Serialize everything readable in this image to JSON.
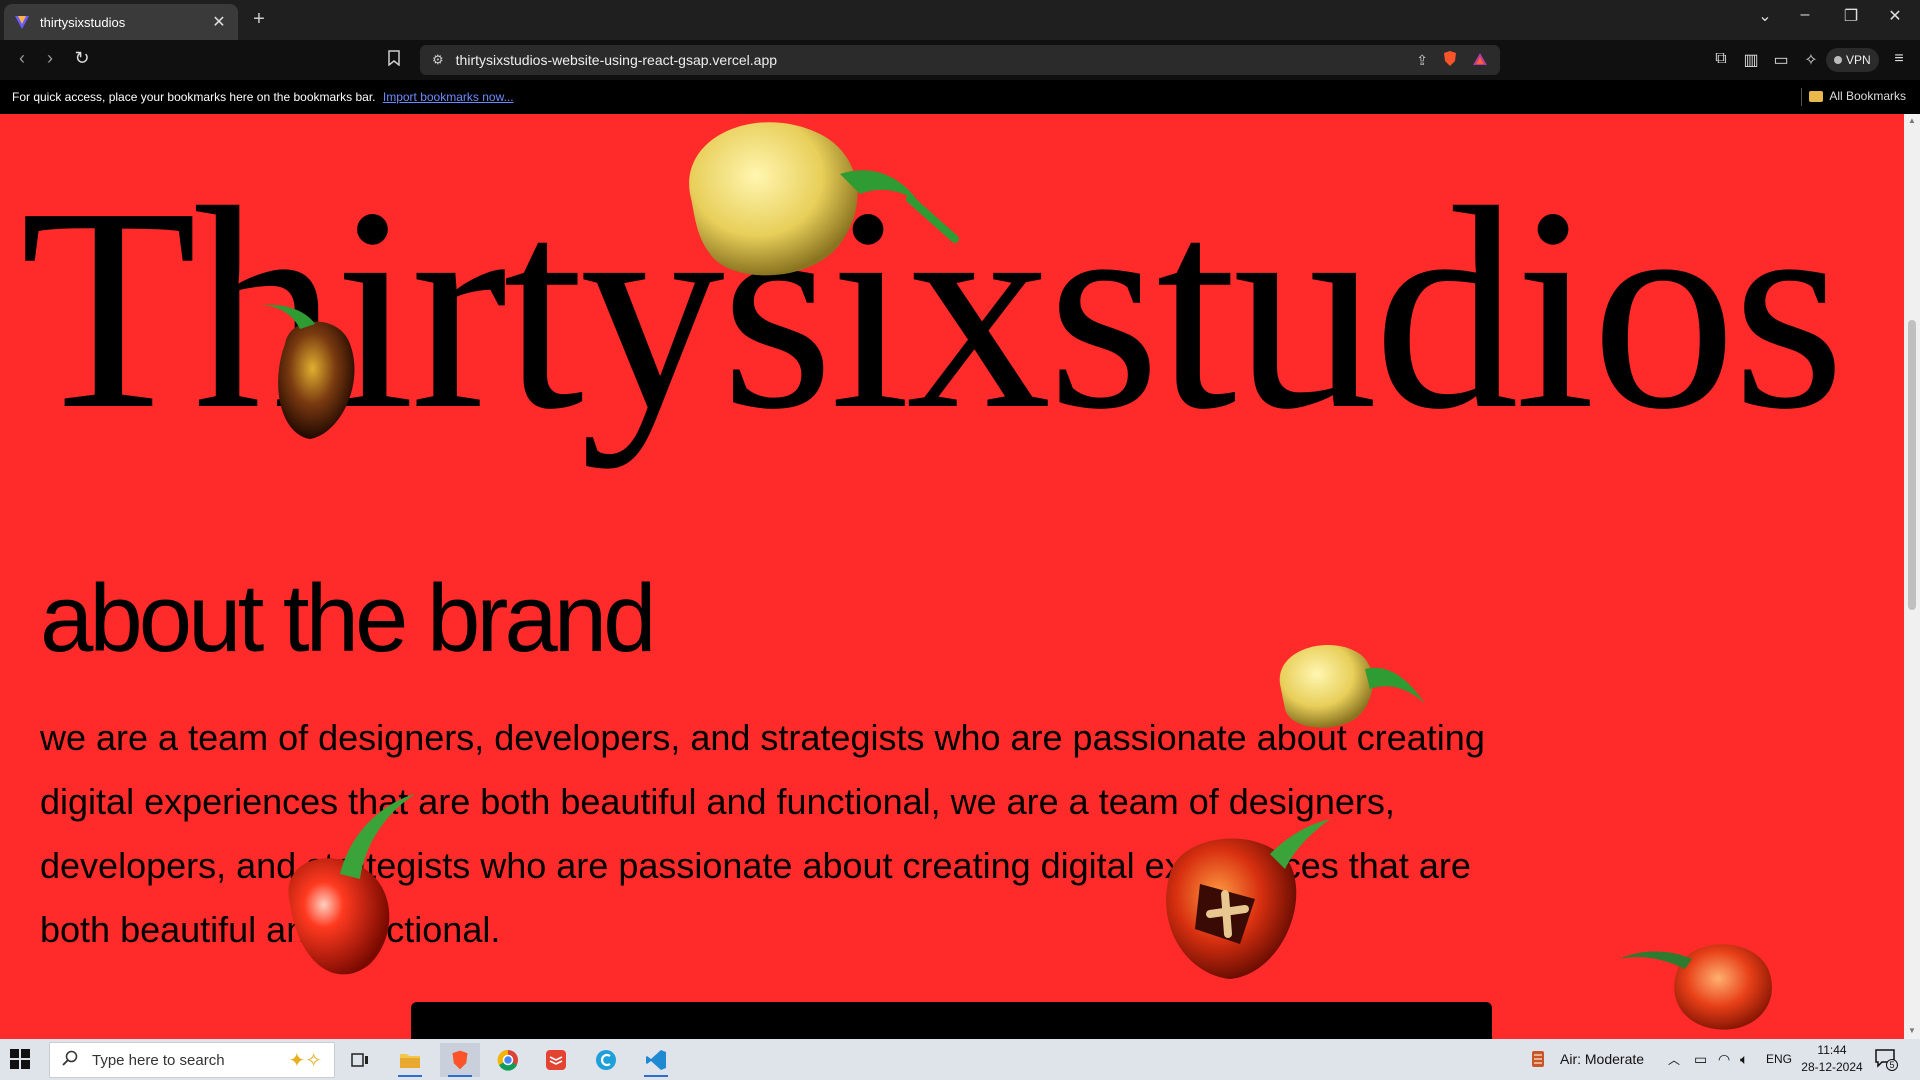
{
  "browser": {
    "tab_title": "thirtysixstudios",
    "url": "thirtysixstudios-website-using-react-gsap.vercel.app",
    "vpn_label": "VPN",
    "bookmarks_prompt": "For quick access, place your bookmarks here on the bookmarks bar.",
    "bookmarks_import_link": "Import bookmarks now...",
    "all_bookmarks_label": "All Bookmarks"
  },
  "page": {
    "hero_title": "Thirtysixstudios",
    "about_title": "about the brand",
    "about_body": "we are a team of designers, developers, and strategists who are passionate about creating digital experiences that are both beautiful and functional, we are a team of designers, developers, and strategists who are passionate about creating digital experiences that are both beautiful and functional.",
    "background_color": "#ff2a2a"
  },
  "taskbar": {
    "search_placeholder": "Type here to search",
    "weather": "Air: Moderate",
    "language": "ENG",
    "time": "11:44",
    "date": "28-12-2024",
    "notification_count": "5"
  }
}
